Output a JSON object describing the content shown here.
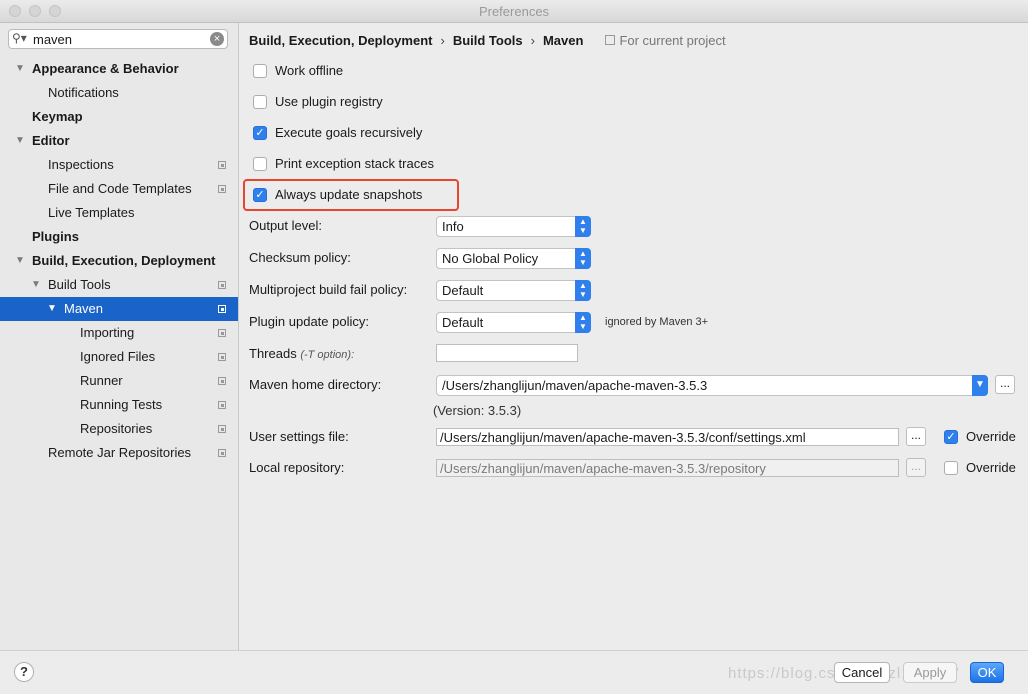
{
  "window": {
    "title": "Preferences"
  },
  "search": {
    "value": "maven"
  },
  "sidebar": {
    "items": [
      {
        "label": "Appearance & Behavior",
        "arrow": "▼",
        "bold": true,
        "level": 0,
        "project": false
      },
      {
        "label": "Notifications",
        "arrow": "",
        "bold": false,
        "level": 1,
        "project": false
      },
      {
        "label": "Keymap",
        "arrow": "",
        "bold": true,
        "level": 0,
        "project": false
      },
      {
        "label": "Editor",
        "arrow": "▼",
        "bold": true,
        "level": 0,
        "project": false
      },
      {
        "label": "Inspections",
        "arrow": "",
        "bold": false,
        "level": 1,
        "project": true
      },
      {
        "label": "File and Code Templates",
        "arrow": "",
        "bold": false,
        "level": 1,
        "project": true
      },
      {
        "label": "Live Templates",
        "arrow": "",
        "bold": false,
        "level": 1,
        "project": false
      },
      {
        "label": "Plugins",
        "arrow": "",
        "bold": true,
        "level": 0,
        "project": false
      },
      {
        "label": "Build, Execution, Deployment",
        "arrow": "▼",
        "bold": true,
        "level": 0,
        "project": false
      },
      {
        "label": "Build Tools",
        "arrow": "▼",
        "bold": false,
        "level": 1,
        "project": true
      },
      {
        "label": "Maven",
        "arrow": "▼",
        "bold": false,
        "level": 2,
        "project": true,
        "selected": true
      },
      {
        "label": "Importing",
        "arrow": "",
        "bold": false,
        "level": 3,
        "project": true
      },
      {
        "label": "Ignored Files",
        "arrow": "",
        "bold": false,
        "level": 3,
        "project": true
      },
      {
        "label": "Runner",
        "arrow": "",
        "bold": false,
        "level": 3,
        "project": true
      },
      {
        "label": "Running Tests",
        "arrow": "",
        "bold": false,
        "level": 3,
        "project": true
      },
      {
        "label": "Repositories",
        "arrow": "",
        "bold": false,
        "level": 3,
        "project": true
      },
      {
        "label": "Remote Jar Repositories",
        "arrow": "",
        "bold": false,
        "level": 1,
        "project": true
      }
    ]
  },
  "breadcrumb": {
    "items": [
      "Build, Execution, Deployment",
      "Build Tools",
      "Maven"
    ],
    "separator": "›",
    "scope": "For current project"
  },
  "options": {
    "work_offline": {
      "label": "Work offline",
      "checked": false
    },
    "use_plugin_registry": {
      "label": "Use plugin registry",
      "checked": false
    },
    "execute_goals_recursively": {
      "label": "Execute goals recursively",
      "checked": true
    },
    "print_exception_stack_traces": {
      "label": "Print exception stack traces",
      "checked": false
    },
    "always_update_snapshots": {
      "label": "Always update snapshots",
      "checked": true
    }
  },
  "fields": {
    "output_level": {
      "label": "Output level:",
      "value": "Info"
    },
    "checksum_policy": {
      "label": "Checksum policy:",
      "value": "No Global Policy"
    },
    "multiproject_fail_policy": {
      "label": "Multiproject build fail policy:",
      "value": "Default"
    },
    "plugin_update_policy": {
      "label": "Plugin update policy:",
      "value": "Default",
      "note": "ignored by Maven 3+"
    },
    "threads": {
      "label": "Threads",
      "hint": "(-T option):",
      "value": ""
    },
    "maven_home": {
      "label": "Maven home directory:",
      "value": "/Users/zhanglijun/maven/apache-maven-3.5.3",
      "version": "(Version: 3.5.3)"
    },
    "user_settings": {
      "label": "User settings file:",
      "value": "/Users/zhanglijun/maven/apache-maven-3.5.3/conf/settings.xml",
      "override_label": "Override",
      "override_checked": true
    },
    "local_repository": {
      "label": "Local repository:",
      "value": "/Users/zhanglijun/maven/apache-maven-3.5.3/repository",
      "override_label": "Override",
      "override_checked": false
    }
  },
  "browse_label": "...",
  "footer": {
    "help": "?",
    "watermark": "https://blog.csdn.net/zl1zl1z17",
    "cancel": "Cancel",
    "apply": "Apply",
    "ok": "OK"
  },
  "colors": {
    "selection": "#1a63c9",
    "accent": "#2f80ed",
    "highlight_border": "#e8452d"
  }
}
